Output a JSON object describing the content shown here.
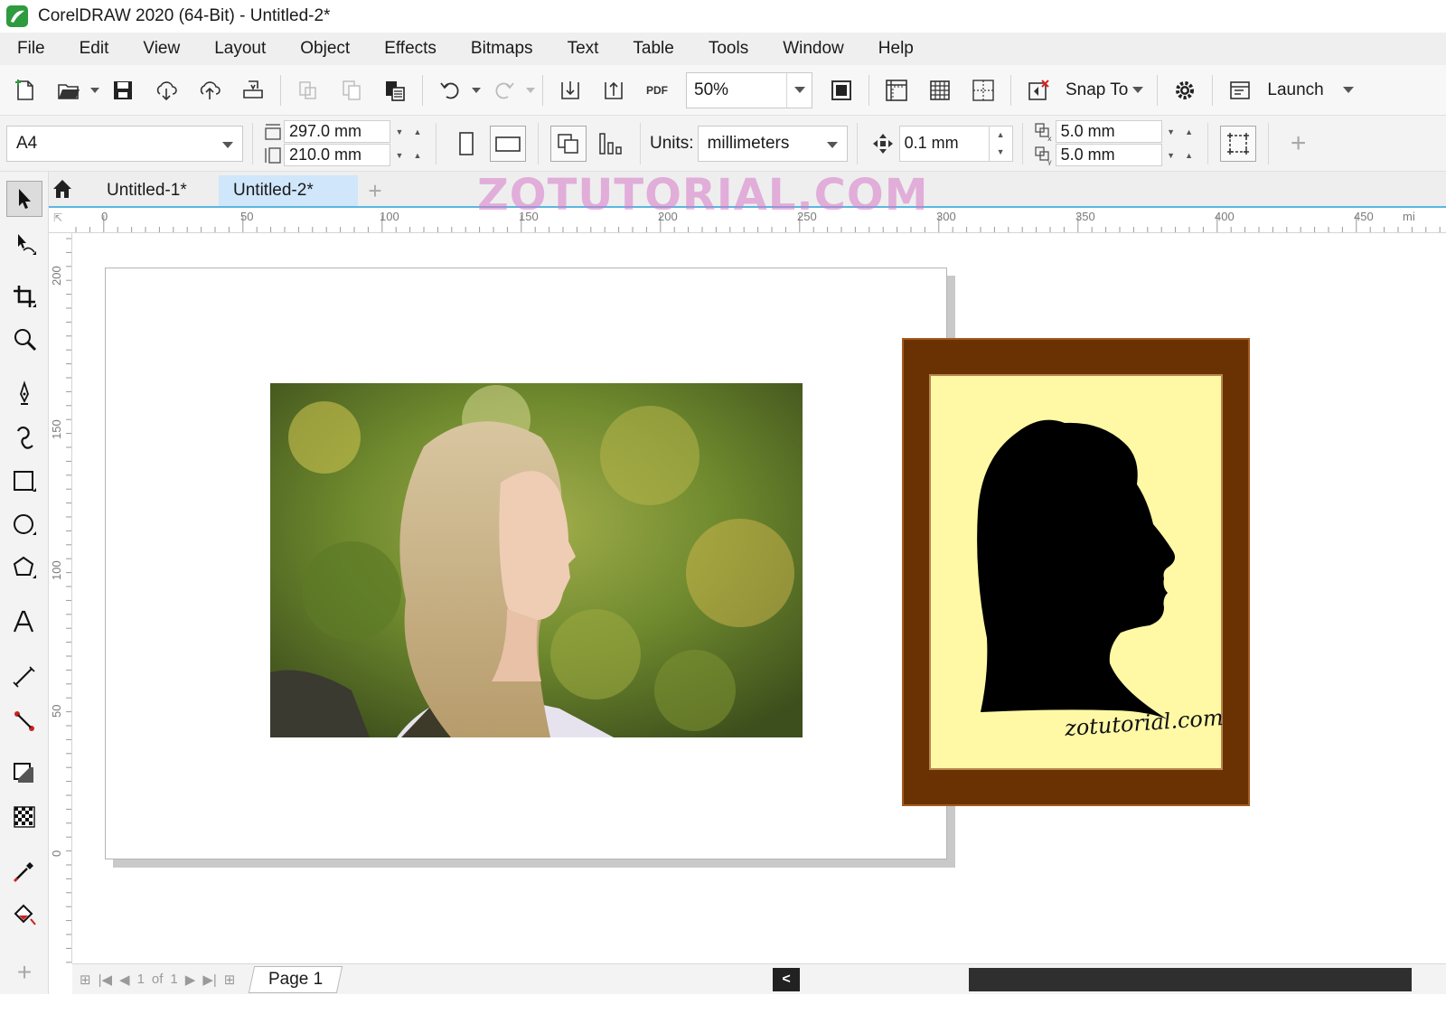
{
  "title_bar": {
    "title": "CorelDRAW 2020 (64-Bit) - Untitled-2*"
  },
  "menu": [
    "File",
    "Edit",
    "View",
    "Layout",
    "Object",
    "Effects",
    "Bitmaps",
    "Text",
    "Table",
    "Tools",
    "Window",
    "Help"
  ],
  "toolbar": {
    "pdf_label": "PDF",
    "zoom": "50%",
    "snap_to": "Snap To",
    "launch": "Launch"
  },
  "property_bar": {
    "page_size": "A4",
    "width": "297.0 mm",
    "height": "210.0 mm",
    "units_label": "Units:",
    "units_value": "millimeters",
    "nudge": "0.1 mm",
    "dup_x": "5.0 mm",
    "dup_y": "5.0 mm"
  },
  "tabs": [
    "Untitled-1*",
    "Untitled-2*"
  ],
  "watermark": "ZOTUTORIAL.COM",
  "ruler": {
    "horizontal": [
      "0",
      "50",
      "100",
      "150",
      "200",
      "250",
      "300",
      "350",
      "400",
      "450",
      "mi"
    ],
    "vertical": [
      "200",
      "150",
      "100",
      "50",
      "0"
    ]
  },
  "canvas": {
    "signature": "zotutorial.com"
  },
  "status": {
    "page_current": "1",
    "page_of": "of",
    "page_total": "1",
    "page_tab": "Page 1"
  },
  "colors": {
    "frame": "#6a3202",
    "frame_inner": "#fff9a6",
    "tab_active": "#cfe6fb",
    "ruler_accent": "#5ab7e0"
  }
}
